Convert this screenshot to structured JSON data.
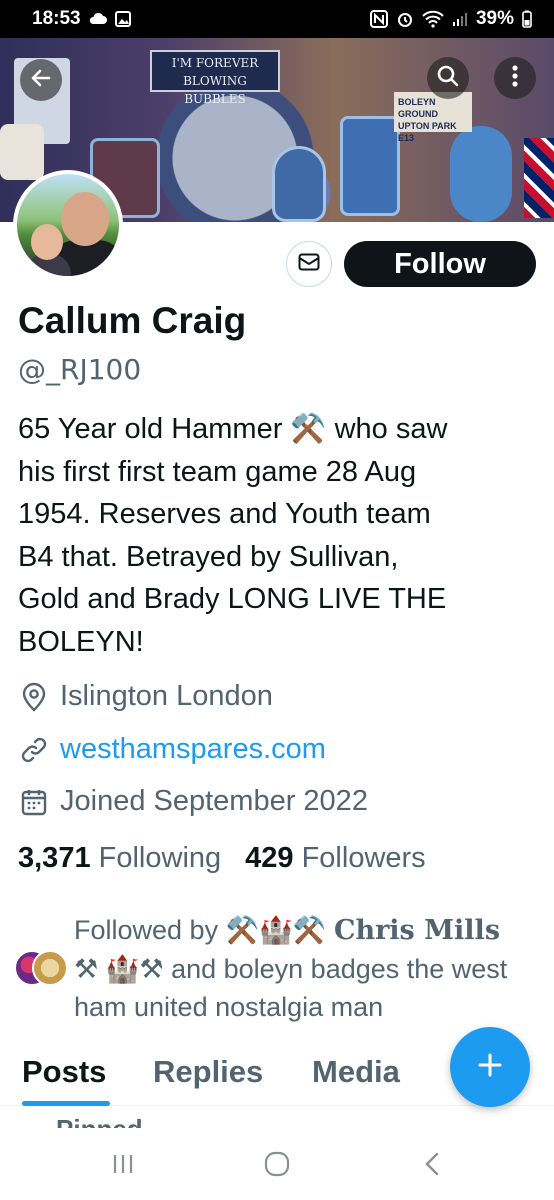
{
  "status_bar": {
    "time": "18:53",
    "battery": "39%",
    "icons": [
      "cloud-icon",
      "image-icon",
      "nfc-icon",
      "alarm-icon",
      "wifi-icon",
      "signal-icon",
      "battery-icon"
    ]
  },
  "banner": {
    "sign_text": "I'M FOREVER BLOWING BUBBLES",
    "plate_text": "BOLEYN GROUND UPTON PARK E13",
    "back_icon": "back-arrow-icon",
    "search_icon": "search-icon",
    "more_icon": "more-vertical-icon"
  },
  "profile": {
    "name": "Callum Craig",
    "handle": "@_RJ100",
    "bio_lines": [
      "65 Year old Hammer ⚒️ who saw",
      "his first first team game 28 Aug",
      "1954. Reserves and Youth team",
      "B4 that. Betrayed by Sullivan,",
      "Gold and Brady LONG LIVE THE",
      "BOLEYN!"
    ],
    "location": "Islington London",
    "website": "westhamspares.com",
    "joined": "Joined September 2022"
  },
  "actions": {
    "message_icon": "mail-icon",
    "follow_label": "Follow"
  },
  "counts": {
    "following_value": "3,371",
    "following_label": "Following",
    "followers_value": "429",
    "followers_label": "Followers"
  },
  "followed_by": {
    "prefix": "Followed by ",
    "emoji_a": "⚒️🏰⚒️",
    "name_a": "Chris Mills",
    "emoji_b": "⚒",
    "line2_emoji": "🏰⚒",
    "rest": " and boleyn badges the west ham united nostalgia man"
  },
  "tabs": [
    {
      "label": "Posts",
      "active": true
    },
    {
      "label": "Replies",
      "active": false
    },
    {
      "label": "Media",
      "active": false
    }
  ],
  "pinned_label": "Pinned",
  "fab_icon": "plus-icon",
  "nav": [
    "recents-icon",
    "home-icon",
    "back-icon"
  ],
  "colors": {
    "accent": "#1d9bf0",
    "text_primary": "#0f1419",
    "text_secondary": "#536471"
  }
}
